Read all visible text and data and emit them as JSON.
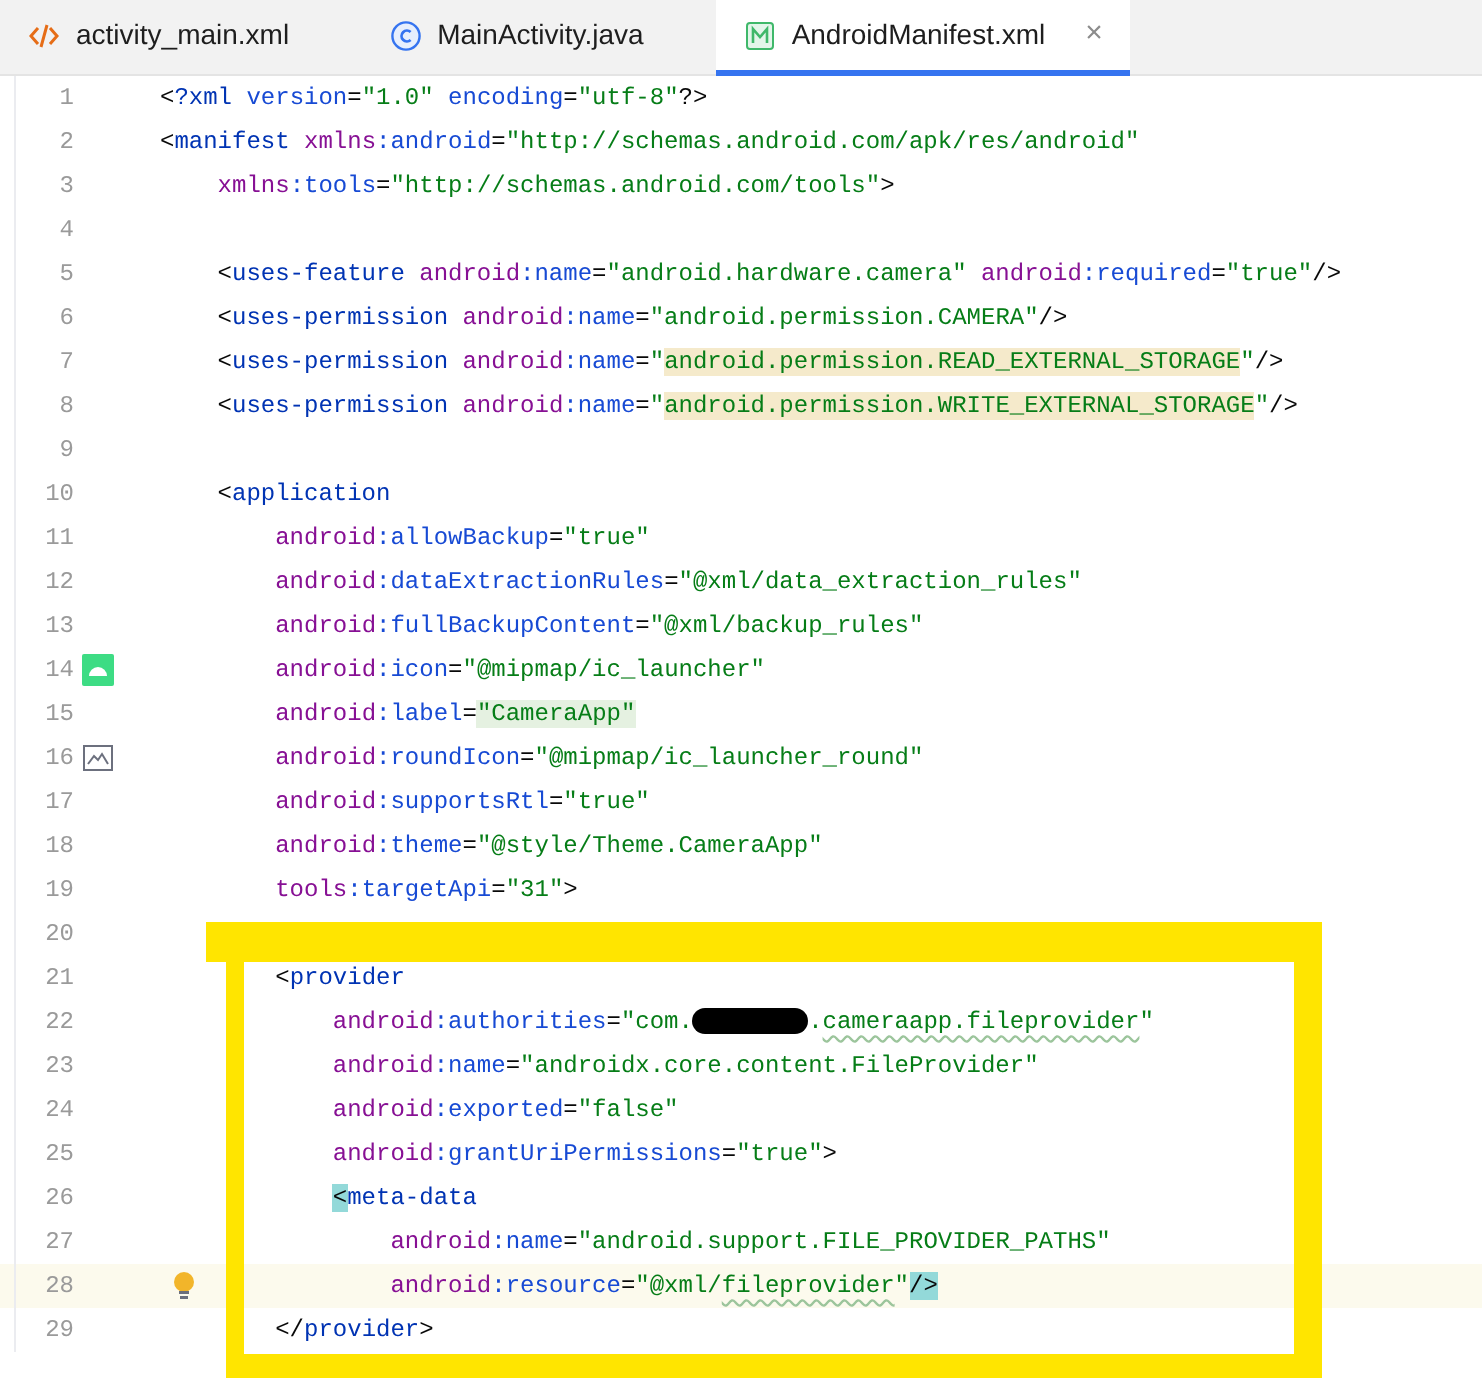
{
  "tabs": [
    {
      "label": "activity_main.xml",
      "kind": "xml",
      "selected": false
    },
    {
      "label": "MainActivity.java",
      "kind": "class",
      "selected": false
    },
    {
      "label": "AndroidManifest.xml",
      "kind": "manifest",
      "selected": true,
      "close": "×"
    }
  ],
  "lines": [
    {
      "number": "1",
      "code": [
        {
          "kind": "punct",
          "text": "<"
        },
        {
          "kind": "tag",
          "text": "?xml"
        },
        {
          "kind": "attr",
          "text": " version"
        },
        {
          "kind": "punct",
          "text": "="
        },
        {
          "kind": "value",
          "text": "\"1.0\""
        },
        {
          "kind": "attr",
          "text": " encoding"
        },
        {
          "kind": "punct",
          "text": "="
        },
        {
          "kind": "value",
          "text": "\"utf-8\""
        },
        {
          "kind": "punct",
          "text": "?>"
        }
      ]
    },
    {
      "number": "2",
      "code": [
        {
          "kind": "punct",
          "text": "<"
        },
        {
          "kind": "tag",
          "text": "manifest"
        },
        {
          "kind": "ns",
          "text": " xmlns"
        },
        {
          "kind": "attr",
          "text": ":android"
        },
        {
          "kind": "punct",
          "text": "="
        },
        {
          "kind": "value",
          "text": "\"http://schemas.android.com/apk/res/android\""
        }
      ],
      "children": [
        {
          "number": "3",
          "code": [
            {
              "kind": "ns",
              "text": "xmlns"
            },
            {
              "kind": "attr",
              "text": ":tools"
            },
            {
              "kind": "punct",
              "text": "="
            },
            {
              "kind": "value",
              "text": "\"http://schemas.android.com/tools\""
            },
            {
              "kind": "punct",
              "text": ">"
            }
          ]
        },
        {
          "number": "4"
        },
        {
          "number": "5",
          "code": [
            {
              "kind": "punct",
              "text": "<"
            },
            {
              "kind": "tag",
              "text": "uses-feature"
            },
            {
              "kind": "ns",
              "text": " android"
            },
            {
              "kind": "attr",
              "text": ":name"
            },
            {
              "kind": "punct",
              "text": "="
            },
            {
              "kind": "value",
              "text": "\"android.hardware.camera\""
            },
            {
              "kind": "ns",
              "text": " android"
            },
            {
              "kind": "attr",
              "text": ":required"
            },
            {
              "kind": "punct",
              "text": "="
            },
            {
              "kind": "value",
              "text": "\"true\""
            },
            {
              "kind": "punct",
              "text": "/>"
            }
          ]
        },
        {
          "number": "6",
          "code": [
            {
              "kind": "punct",
              "text": "<"
            },
            {
              "kind": "tag",
              "text": "uses-permission"
            },
            {
              "kind": "ns",
              "text": " android"
            },
            {
              "kind": "attr",
              "text": ":name"
            },
            {
              "kind": "punct",
              "text": "="
            },
            {
              "kind": "value",
              "text": "\"android.permission.CAMERA\""
            },
            {
              "kind": "punct",
              "text": "/>"
            }
          ]
        },
        {
          "number": "7",
          "code": [
            {
              "kind": "punct",
              "text": "<"
            },
            {
              "kind": "tag",
              "text": "uses-permission"
            },
            {
              "kind": "ns",
              "text": " android"
            },
            {
              "kind": "attr",
              "text": ":name"
            },
            {
              "kind": "punct",
              "text": "="
            },
            {
              "kind": "value",
              "text": "\""
            },
            {
              "kind": "value",
              "text": "android.permission.READ_EXTERNAL_STORAGE",
              "color": "#f5eacb"
            },
            {
              "kind": "value",
              "text": "\""
            },
            {
              "kind": "punct",
              "text": "/>"
            }
          ]
        },
        {
          "number": "8",
          "code": [
            {
              "kind": "punct",
              "text": "<"
            },
            {
              "kind": "tag",
              "text": "uses-permission"
            },
            {
              "kind": "ns",
              "text": " android"
            },
            {
              "kind": "attr",
              "text": ":name"
            },
            {
              "kind": "punct",
              "text": "="
            },
            {
              "kind": "value",
              "text": "\""
            },
            {
              "kind": "value",
              "text": "android.permission.WRITE_EXTERNAL_STORAGE",
              "color": "#f5eacb"
            },
            {
              "kind": "value",
              "text": "\""
            },
            {
              "kind": "punct",
              "text": "/>"
            }
          ]
        },
        {
          "number": "9"
        },
        {
          "number": "10",
          "code": [
            {
              "kind": "punct",
              "text": "<"
            },
            {
              "kind": "tag",
              "text": "application"
            }
          ],
          "children": [
            {
              "number": "11",
              "code": [
                {
                  "kind": "ns",
                  "text": "android"
                },
                {
                  "kind": "attr",
                  "text": ":allowBackup"
                },
                {
                  "kind": "punct",
                  "text": "="
                },
                {
                  "kind": "value",
                  "text": "\"true\""
                }
              ]
            },
            {
              "number": "12",
              "code": [
                {
                  "kind": "ns",
                  "text": "android"
                },
                {
                  "kind": "attr",
                  "text": ":dataExtractionRules"
                },
                {
                  "kind": "punct",
                  "text": "="
                },
                {
                  "kind": "value",
                  "text": "\"@xml/data_extraction_rules\""
                }
              ]
            },
            {
              "number": "13",
              "code": [
                {
                  "kind": "ns",
                  "text": "android"
                },
                {
                  "kind": "attr",
                  "text": ":fullBackupContent"
                },
                {
                  "kind": "punct",
                  "text": "="
                },
                {
                  "kind": "value",
                  "text": "\"@xml/backup_rules\""
                }
              ]
            },
            {
              "number": "14",
              "gutter_icon": {
                "kind": "android"
              },
              "code": [
                {
                  "kind": "ns",
                  "text": "android"
                },
                {
                  "kind": "attr",
                  "text": ":icon"
                },
                {
                  "kind": "punct",
                  "text": "="
                },
                {
                  "kind": "value",
                  "text": "\"@mipmap/ic_launcher\""
                }
              ]
            },
            {
              "number": "15",
              "code": [
                {
                  "kind": "ns",
                  "text": "android"
                },
                {
                  "kind": "attr",
                  "text": ":label"
                },
                {
                  "kind": "punct",
                  "text": "="
                },
                {
                  "kind": "value",
                  "text": "\"CameraApp\"",
                  "color": "#e5f1e1"
                }
              ]
            },
            {
              "number": "16",
              "gutter_icon": {
                "kind": "image"
              },
              "code": [
                {
                  "kind": "ns",
                  "text": "android"
                },
                {
                  "kind": "attr",
                  "text": ":roundIcon"
                },
                {
                  "kind": "punct",
                  "text": "="
                },
                {
                  "kind": "value",
                  "text": "\"@mipmap/ic_launcher_round\""
                }
              ]
            },
            {
              "number": "17",
              "code": [
                {
                  "kind": "ns",
                  "text": "android"
                },
                {
                  "kind": "attr",
                  "text": ":supportsRtl"
                },
                {
                  "kind": "punct",
                  "text": "="
                },
                {
                  "kind": "value",
                  "text": "\"true\""
                }
              ]
            },
            {
              "number": "18",
              "code": [
                {
                  "kind": "ns",
                  "text": "android"
                },
                {
                  "kind": "attr",
                  "text": ":theme"
                },
                {
                  "kind": "punct",
                  "text": "="
                },
                {
                  "kind": "value",
                  "text": "\"@style/Theme.CameraApp\""
                }
              ]
            },
            {
              "number": "19",
              "code": [
                {
                  "kind": "ns",
                  "text": "tools"
                },
                {
                  "kind": "attr",
                  "text": ":targetApi"
                },
                {
                  "kind": "punct",
                  "text": "="
                },
                {
                  "kind": "value",
                  "text": "\"31\""
                },
                {
                  "kind": "punct",
                  "text": ">"
                }
              ]
            },
            {
              "number": "20"
            },
            {
              "number": "21",
              "code": [
                {
                  "kind": "punct",
                  "text": "<"
                },
                {
                  "kind": "tag",
                  "text": "provider"
                }
              ],
              "children": [
                {
                  "number": "22",
                  "code": [
                    {
                      "kind": "ns",
                      "text": "android"
                    },
                    {
                      "kind": "attr",
                      "text": ":authorities"
                    },
                    {
                      "kind": "punct",
                      "text": "="
                    },
                    {
                      "kind": "value",
                      "text": "\"com."
                    },
                    {
                      "kind": "redaction"
                    },
                    {
                      "kind": "value",
                      "text": "."
                    },
                    {
                      "kind": "value",
                      "text": "cameraapp.fileprovider",
                      "typo": true
                    },
                    {
                      "kind": "value",
                      "text": "\""
                    }
                  ]
                },
                {
                  "number": "23",
                  "code": [
                    {
                      "kind": "ns",
                      "text": "android"
                    },
                    {
                      "kind": "attr",
                      "text": ":name"
                    },
                    {
                      "kind": "punct",
                      "text": "="
                    },
                    {
                      "kind": "value",
                      "text": "\"androidx.core.content.FileProvider\""
                    }
                  ]
                },
                {
                  "number": "24",
                  "code": [
                    {
                      "kind": "ns",
                      "text": "android"
                    },
                    {
                      "kind": "attr",
                      "text": ":exported"
                    },
                    {
                      "kind": "punct",
                      "text": "="
                    },
                    {
                      "kind": "value",
                      "text": "\"false\""
                    }
                  ]
                },
                {
                  "number": "25",
                  "code": [
                    {
                      "kind": "ns",
                      "text": "android"
                    },
                    {
                      "kind": "attr",
                      "text": ":grantUriPermissions"
                    },
                    {
                      "kind": "punct",
                      "text": "="
                    },
                    {
                      "kind": "value",
                      "text": "\"true\""
                    },
                    {
                      "kind": "punct",
                      "text": ">"
                    }
                  ]
                },
                {
                  "number": "26",
                  "code": [
                    {
                      "kind": "punct",
                      "text": "<",
                      "color": "#93d9d9"
                    },
                    {
                      "kind": "tag",
                      "text": "meta-data"
                    }
                  ],
                  "children": [
                    {
                      "number": "27",
                      "code": [
                        {
                          "kind": "ns",
                          "text": "android"
                        },
                        {
                          "kind": "attr",
                          "text": ":name"
                        },
                        {
                          "kind": "punct",
                          "text": "="
                        },
                        {
                          "kind": "value",
                          "text": "\"android.support.FILE_PROVIDER_PATHS\""
                        }
                      ]
                    },
                    {
                      "number": "28",
                      "current": true,
                      "gutter_icon": {
                        "kind": "bulb"
                      },
                      "code": [
                        {
                          "kind": "ns",
                          "text": "android"
                        },
                        {
                          "kind": "attr",
                          "text": ":resource"
                        },
                        {
                          "kind": "punct",
                          "text": "="
                        },
                        {
                          "kind": "value",
                          "text": "\"@xml/"
                        },
                        {
                          "kind": "value",
                          "text": "fileprovider",
                          "typo": true
                        },
                        {
                          "kind": "value",
                          "text": "\""
                        },
                        {
                          "kind": "punct",
                          "text": "/>",
                          "color": "#93d9d9"
                        }
                      ]
                    }
                  ]
                }
              ]
            },
            {
              "number": "29",
              "code": [
                {
                  "kind": "punct",
                  "text": "</"
                },
                {
                  "kind": "tag",
                  "text": "provider"
                },
                {
                  "kind": "punct",
                  "text": ">"
                }
              ]
            }
          ]
        }
      ]
    }
  ]
}
